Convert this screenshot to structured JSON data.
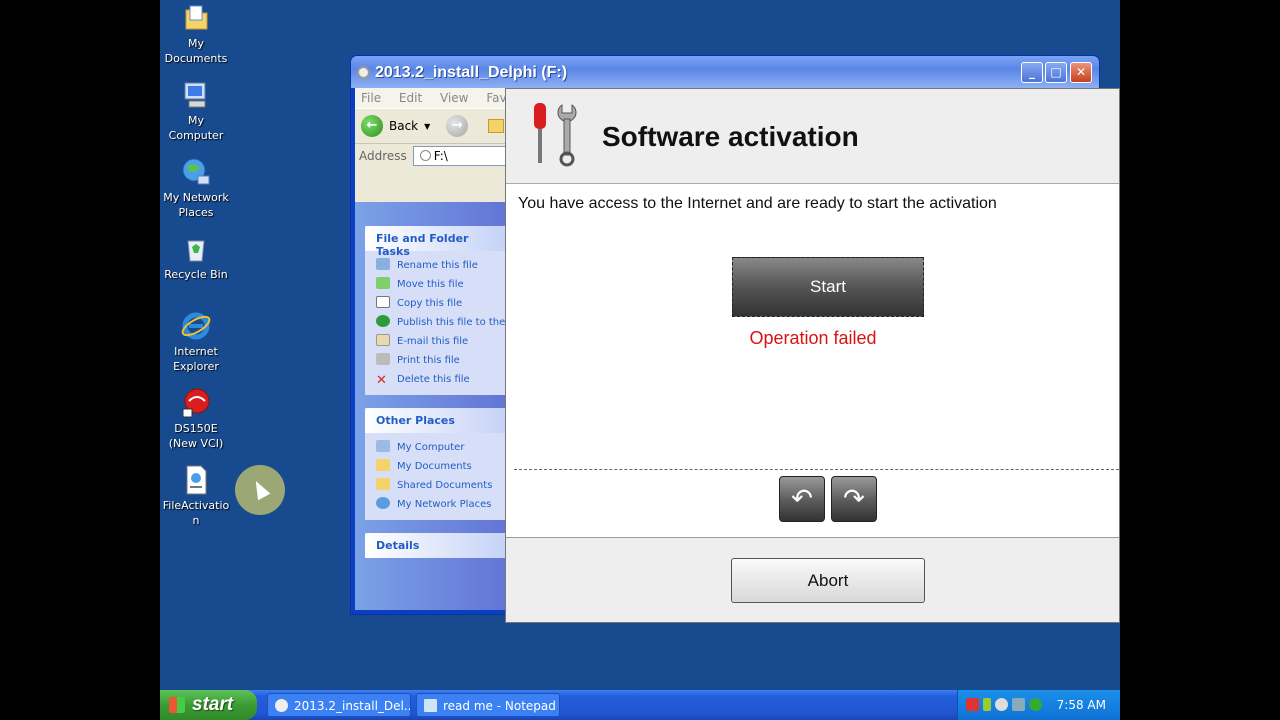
{
  "desktop": {
    "icons": [
      {
        "label_line1": "My",
        "label_line2": "Documents",
        "icon": "my-documents-icon"
      },
      {
        "label_line1": "My",
        "label_line2": "Computer",
        "icon": "my-computer-icon"
      },
      {
        "label_line1": "My Network",
        "label_line2": "Places",
        "icon": "network-places-icon"
      },
      {
        "label_line1": "Recycle Bin",
        "label_line2": "",
        "icon": "recycle-bin-icon"
      },
      {
        "label_line1": "Internet",
        "label_line2": "Explorer",
        "icon": "internet-explorer-icon"
      },
      {
        "label_line1": "DS150E",
        "label_line2": "(New VCI)",
        "icon": "ds150e-icon"
      },
      {
        "label_line1": "FileActivatio",
        "label_line2": "n",
        "icon": "file-activation-icon"
      }
    ]
  },
  "explorer": {
    "title": "2013.2_install_Delphi (F:)",
    "menu": [
      "File",
      "Edit",
      "View",
      "Favor"
    ],
    "back_label": "Back",
    "address_label": "Address",
    "address_value": "F:\\",
    "file_tasks": {
      "heading": "File and Folder Tasks",
      "items": [
        "Rename this file",
        "Move this file",
        "Copy this file",
        "Publish this file to the W",
        "E-mail this file",
        "Print this file",
        "Delete this file"
      ]
    },
    "other_places": {
      "heading": "Other Places",
      "items": [
        "My Computer",
        "My Documents",
        "Shared Documents",
        "My Network Places"
      ]
    },
    "details_heading": "Details"
  },
  "dialog": {
    "title": "Software activation",
    "message": "You have access to the Internet and are ready to start the activation",
    "start_label": "Start",
    "status": "Operation failed",
    "back_arrow": "↶",
    "forward_arrow": "↷",
    "abort_label": "Abort",
    "status_color": "#d71414"
  },
  "taskbar": {
    "start_label": "start",
    "tasks": [
      "2013.2_install_Del...",
      "read me - Notepad"
    ],
    "clock": "7:58 AM"
  }
}
